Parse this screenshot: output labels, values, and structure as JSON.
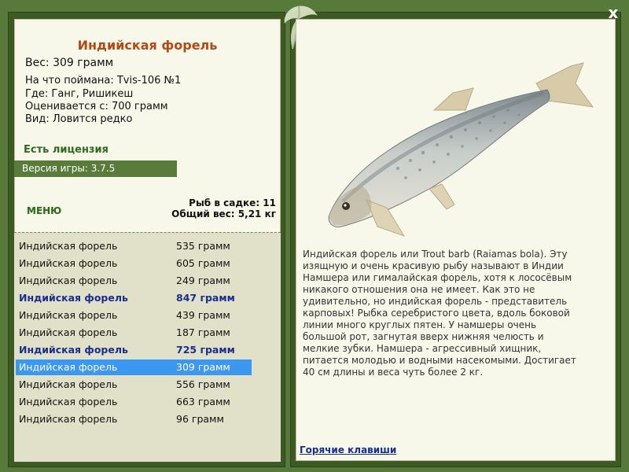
{
  "title": "Индийская форель",
  "weight": "Вес: 309 грамм",
  "caught_on": "На что поймана: Tvis-106 №1",
  "location": "Где: Ганг, Ришикеш",
  "valued_from": "Оценивается с: 700 грамм",
  "rarity": "Вид: Ловится редко",
  "license": "Есть лицензия",
  "version": "Версия игры: 3.7.5",
  "menu_label": "МЕНЮ",
  "stats": {
    "count": "Рыб в садке: 11",
    "total": "Общий вес: 5,21 кг"
  },
  "list": [
    {
      "name": "Индийская форель",
      "weight": "535 грамм"
    },
    {
      "name": "Индийская форель",
      "weight": "605 грамм"
    },
    {
      "name": "Индийская форель",
      "weight": "249 грамм"
    },
    {
      "name": "Индийская форель",
      "weight": "847 грамм"
    },
    {
      "name": "Индийская форель",
      "weight": "439 грамм"
    },
    {
      "name": "Индийская форель",
      "weight": "187 грамм"
    },
    {
      "name": "Индийская форель",
      "weight": "725 грамм"
    },
    {
      "name": "Индийская форель",
      "weight": "309 грамм"
    },
    {
      "name": "Индийская форель",
      "weight": "556 грамм"
    },
    {
      "name": "Индийская форель",
      "weight": "663 грамм"
    },
    {
      "name": "Индийская форель",
      "weight": "96 грамм"
    }
  ],
  "description": "Индийская форель или Trout barb (Raiamas bola). Эту изящную и очень красивую рыбу называют в Индии Намшера или гималайская форель, хотя к лососёвым никакого отношения она не имеет. Как это не удивительно, но индийская форель - представитель карповых! Рыбка серебристого цвета, вдоль боковой линии много круглых пятен. У намшеры очень большой рот, загнутая вверх нижняя челюсть и мелкие зубки. Намшера - агрессивный хищник, питается молодью и водными насекомыми. Достигает 40 см длины и веса чуть более 2 кг.",
  "hotkeys": "Горячие клавиши",
  "close_label": "x",
  "colors": {
    "frame": "#57793a",
    "panel": "#f7f7ea",
    "title": "#b34a14",
    "selected": "#3c97f0",
    "highlight": "#1a2e8c"
  }
}
